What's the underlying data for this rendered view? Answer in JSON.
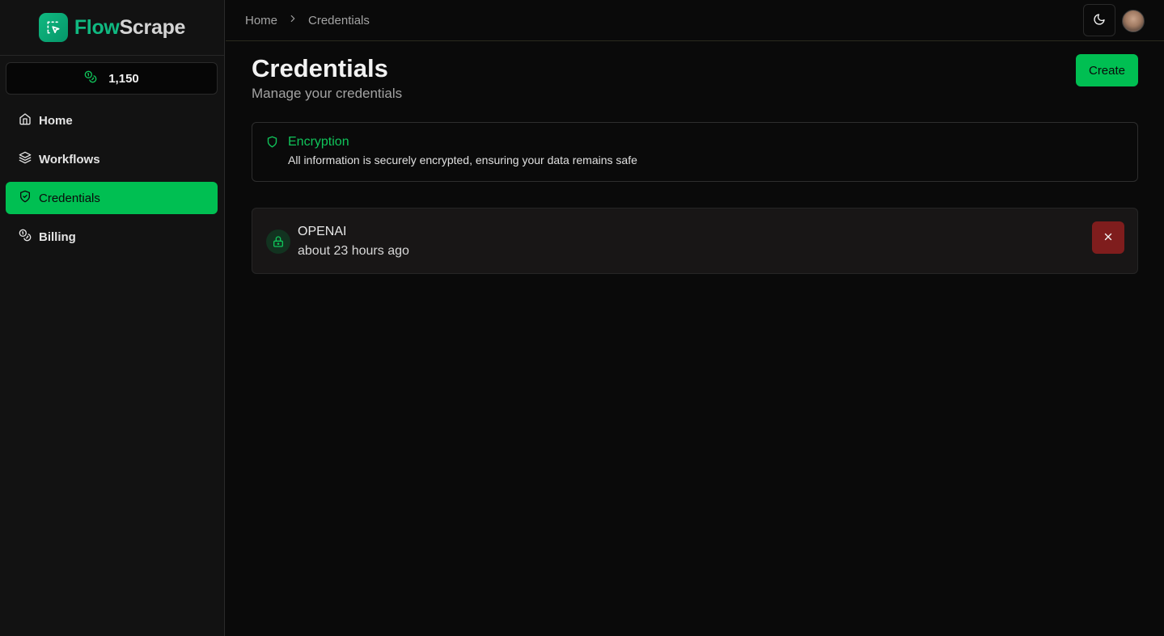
{
  "brand": {
    "part1": "Flow",
    "part2": "Scrape",
    "accent": "#10b981",
    "icon": "cursor-select-icon"
  },
  "credits": {
    "value": "1,150",
    "icon": "coins-icon"
  },
  "sidebar": {
    "items": [
      {
        "label": "Home",
        "icon": "home-icon",
        "active": false
      },
      {
        "label": "Workflows",
        "icon": "layers-icon",
        "active": false
      },
      {
        "label": "Credentials",
        "icon": "shield-check-icon",
        "active": true
      },
      {
        "label": "Billing",
        "icon": "coins-icon",
        "active": false
      }
    ]
  },
  "header": {
    "breadcrumb": [
      "Home",
      "Credentials"
    ],
    "theme_toggle_icon": "moon-icon"
  },
  "main": {
    "title": "Credentials",
    "subtitle": "Manage your credentials",
    "create_label": "Create",
    "encryption": {
      "title": "Encryption",
      "description": "All information is securely encrypted, ensuring your data remains safe"
    },
    "credentials": [
      {
        "name": "OPENAI",
        "time": "about 23 hours ago",
        "icon": "lock-icon"
      }
    ]
  },
  "colors": {
    "primary": "#00bf52",
    "danger": "#7f1d1d",
    "background": "#0a0a0a",
    "sidebar": "#121212"
  }
}
